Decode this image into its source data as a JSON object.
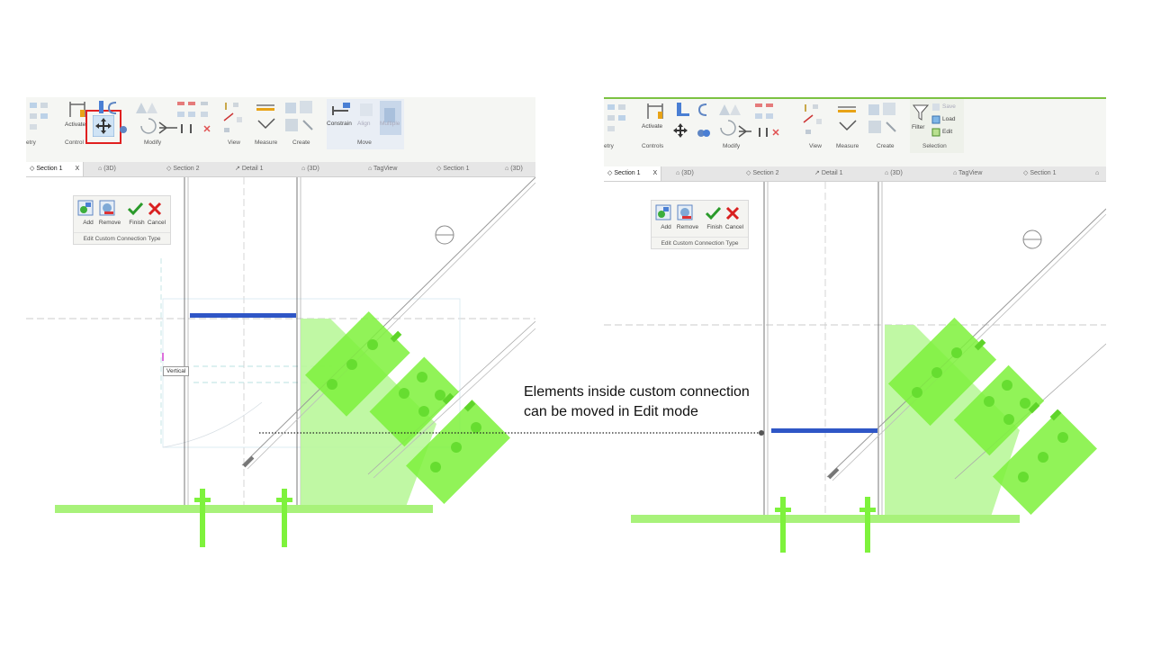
{
  "annotation": {
    "line1": "Elements inside custom connection",
    "line2": "can be moved in Edit mode"
  },
  "left": {
    "ribbon": {
      "tools": {
        "activate": "Activate"
      },
      "panels": {
        "geometry_partial": "etry",
        "controls": "Control",
        "modify": "Modify",
        "view": "View",
        "measure": "Measure",
        "create": "Create",
        "move": "Move"
      },
      "move_tools": {
        "constrain": "Constrain",
        "align": "Align",
        "multiple": "Multiple"
      },
      "highlighted_tool_icon": "move-icon"
    },
    "tabs": [
      {
        "label": "Section 1",
        "active": true,
        "close": "X"
      },
      {
        "label": "(3D)"
      },
      {
        "label": "Section 2"
      },
      {
        "label": "Detail 1"
      },
      {
        "label": "(3D)"
      },
      {
        "label": "TagView"
      },
      {
        "label": "Section 1"
      },
      {
        "label": "(3D)"
      }
    ],
    "panel": {
      "buttons": {
        "add": "Add",
        "remove": "Remove",
        "finish": "Finish",
        "cancel": "Cancel"
      },
      "title": "Edit Custom Connection Type"
    },
    "tooltip": "Vertical"
  },
  "right": {
    "ribbon": {
      "tools": {
        "activate": "Activate",
        "filter": "Filter",
        "save": "Save",
        "load": "Load",
        "edit": "Edit"
      },
      "panels": {
        "geometry_partial": "etry",
        "controls": "Controls",
        "modify": "Modify",
        "view": "View",
        "measure": "Measure",
        "create": "Create",
        "selection": "Selection"
      }
    },
    "tabs": [
      {
        "label": "Section 1",
        "active": true,
        "close": "X"
      },
      {
        "label": "(3D)"
      },
      {
        "label": "Section 2"
      },
      {
        "label": "Detail 1"
      },
      {
        "label": "(3D)"
      },
      {
        "label": "TagView"
      },
      {
        "label": "Section 1"
      }
    ],
    "panel": {
      "buttons": {
        "add": "Add",
        "remove": "Remove",
        "finish": "Finish",
        "cancel": "Cancel"
      },
      "title": "Edit Custom Connection Type"
    }
  },
  "colors": {
    "steel_green": "#7ef23c",
    "plate_green": "#b9f79a",
    "beam_blue": "#2f56c6",
    "ribbon_accent": "#7cc242",
    "highlight_red": "#e02020"
  }
}
